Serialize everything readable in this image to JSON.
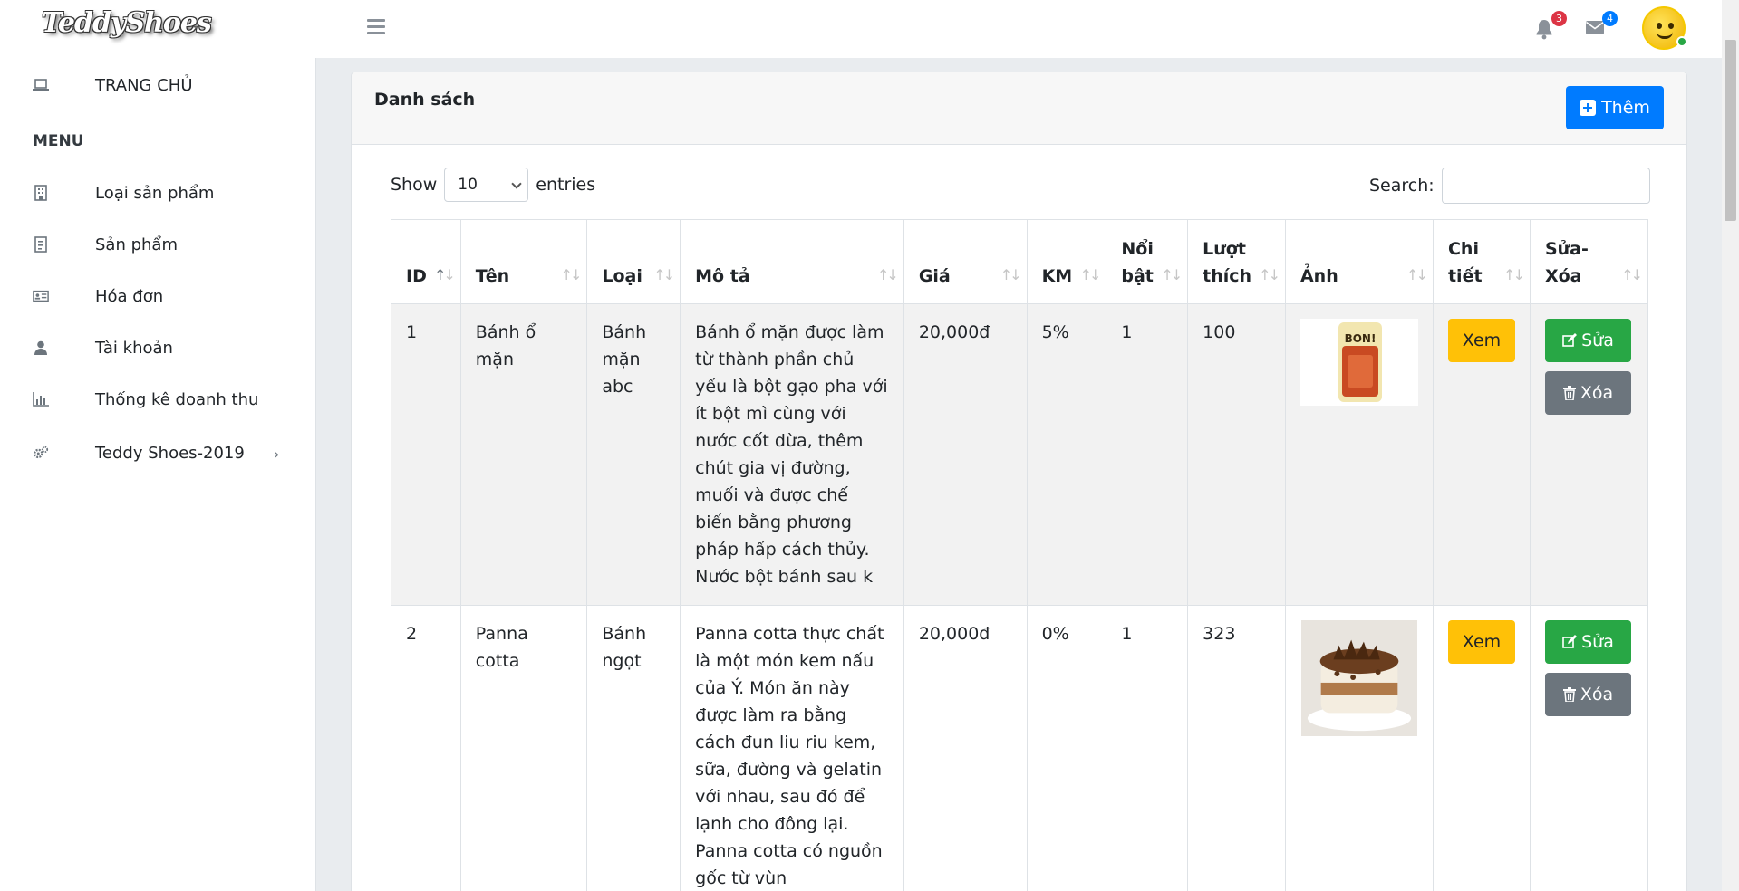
{
  "app": {
    "logo": "TeddyShoes"
  },
  "header": {
    "notifications_count": "3",
    "messages_count": "4"
  },
  "sidebar": {
    "home_label": "TRANG CHỦ",
    "menu_heading": "MENU",
    "items": [
      {
        "label": "Loại sản phẩm",
        "icon": "building-icon"
      },
      {
        "label": "Sản phẩm",
        "icon": "receipt-icon"
      },
      {
        "label": "Hóa đơn",
        "icon": "id-card-icon"
      },
      {
        "label": "Tài khoản",
        "icon": "user-icon"
      },
      {
        "label": "Thống kê doanh thu",
        "icon": "bar-chart-icon"
      },
      {
        "label": "Teddy Shoes-2019",
        "icon": "cogs-icon"
      }
    ]
  },
  "card": {
    "title": "Danh sách",
    "add_label": "Thêm"
  },
  "controls": {
    "show_label": "Show",
    "entries_value": "10",
    "entries_label": "entries",
    "search_label": "Search:",
    "search_value": ""
  },
  "table": {
    "headers": {
      "id": "ID",
      "name": "Tên",
      "type": "Loại",
      "desc": "Mô tả",
      "price": "Giá",
      "km": "KM",
      "featured_1": "Nổi",
      "featured_2": "bật",
      "likes_1": "Lượt",
      "likes_2": "thích",
      "image": "Ảnh",
      "detail_1": "Chi",
      "detail_2": "tiết",
      "edit_1": "Sửa-",
      "edit_2": "Xóa"
    },
    "rows": [
      {
        "id": "1",
        "name": "Bánh ổ mặn",
        "type": "Bánh mặn abc",
        "desc": "Bánh ổ mặn được làm từ thành phần chủ yếu là bột gạo pha với ít bột mì cùng với nước cốt dừa, thêm chút gia vị đường, muối và được chế biến bằng phương pháp hấp cách thủy. Nước bột bánh sau k",
        "price": "20,000đ",
        "km": "5%",
        "featured": "1",
        "likes": "100",
        "image_label": "BON!",
        "detail_label": "Xem",
        "edit_label": "Sửa",
        "delete_label": "Xóa"
      },
      {
        "id": "2",
        "name": "Panna cotta",
        "type": "Bánh ngọt",
        "desc": "Panna cotta thực chất là một món kem nấu của Ý. Món ăn này được làm ra bằng cách đun liu riu kem, sữa, đường và gelatin với nhau, sau đó để lạnh cho đông lại. Panna cotta có nguồn gốc từ vùn",
        "price": "20,000đ",
        "km": "0%",
        "featured": "1",
        "likes": "323",
        "detail_label": "Xem",
        "edit_label": "Sửa",
        "delete_label": "Xóa"
      }
    ]
  },
  "colors": {
    "primary": "#007bff",
    "success": "#28a745",
    "warning": "#ffc107",
    "secondary": "#6c757d"
  }
}
